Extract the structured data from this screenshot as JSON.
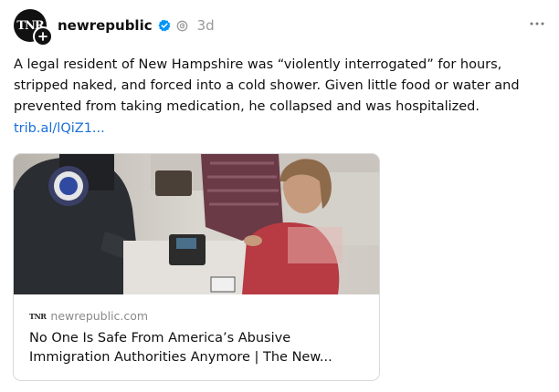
{
  "post": {
    "avatar_text": "TNR",
    "username": "newrepublic",
    "time": "3d",
    "text": "A legal resident of New Hampshire was “violently interrogated” for hours, stripped naked, and forced into a cold shower. Given little food or water and prevented from taking medication, he collapsed and was hospitalized.",
    "link": "trib.al/lQiZ1...",
    "icons": {
      "verified": "verified-badge-icon",
      "meta": "threads-meta-icon",
      "more": "more-ellipsis-icon",
      "follow": "plus-icon"
    },
    "colors": {
      "verified": "#0095f6",
      "link": "#1a6fd9"
    }
  },
  "card": {
    "favicon_text": "TNR",
    "domain": "newrepublic.com",
    "title": "No One Is Safe From America’s Abusive Immigration Authorities Anymore | The New..."
  }
}
